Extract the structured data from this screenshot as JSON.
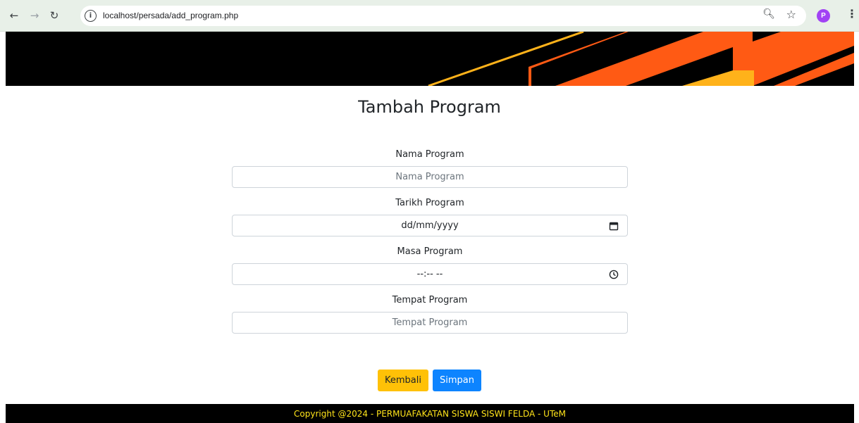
{
  "browser": {
    "url": "localhost/persada/add_program.php",
    "profile_initial": "P",
    "nav_icons": [
      "back-icon",
      "forward-icon",
      "reload-icon",
      "info-icon",
      "zoom-icon",
      "star-icon",
      "kebab-menu-icon"
    ]
  },
  "banner": {
    "colors": {
      "background": "#000000",
      "orange": "#ff5a14",
      "yellow": "#ffb21a"
    }
  },
  "page": {
    "title": "Tambah Program"
  },
  "form": {
    "nama": {
      "label": "Nama Program",
      "placeholder": "Nama Program"
    },
    "tarikh": {
      "label": "Tarikh Program",
      "value": "dd/mm/yyyy",
      "icon": "calendar-icon"
    },
    "masa": {
      "label": "Masa Program",
      "value": "--:-- --",
      "icon": "clock-icon"
    },
    "tempat": {
      "label": "Tempat Program",
      "placeholder": "Tempat Program"
    }
  },
  "buttons": {
    "back": {
      "label": "Kembali",
      "color": "#ffc107"
    },
    "save": {
      "label": "Simpan",
      "color": "#0d84ff"
    }
  },
  "footer": {
    "text": "Copyright @2024 - PERMUAFAKATAN SISWA SISWI FELDA - UTeM",
    "color": "#ffe41a"
  }
}
